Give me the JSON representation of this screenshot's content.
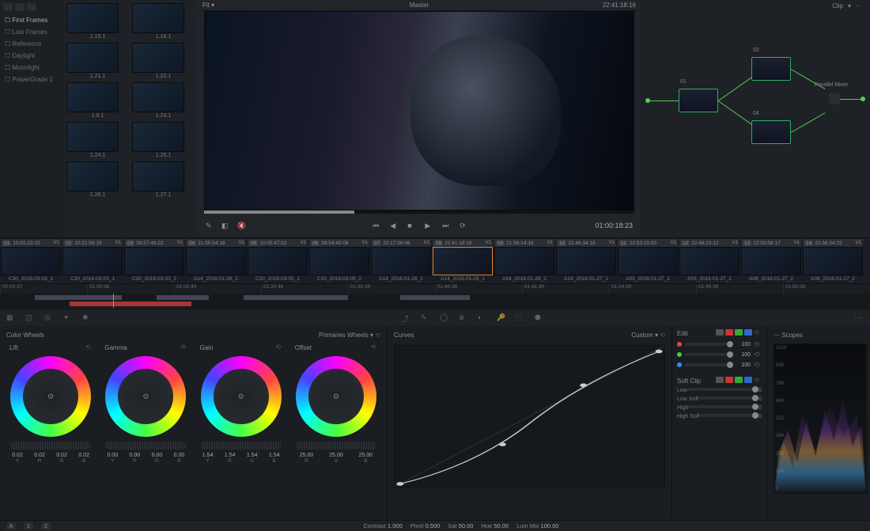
{
  "header": {
    "fit": "Fit",
    "master": "Master",
    "timecode_top": "22:41:18:16",
    "clip_label": "Clip"
  },
  "tags": [
    "First Frames",
    "Last Frames",
    "Reference",
    "Daylight",
    "Moonlight",
    "PowerGrade 1"
  ],
  "thumbs": [
    {
      "label": "1.15.1"
    },
    {
      "label": "1.16.1"
    },
    {
      "label": "1.21.1"
    },
    {
      "label": "1.22.1"
    },
    {
      "label": "1.9.1"
    },
    {
      "label": "1.23.1"
    },
    {
      "label": "1.24.1"
    },
    {
      "label": "1.25.1"
    },
    {
      "label": "1.26.1"
    },
    {
      "label": "1.27.1"
    }
  ],
  "transport": {
    "timecode": "01:00:18:23"
  },
  "nodes": {
    "n1": "01",
    "n2": "02",
    "n3": "04",
    "mixer": "Parallel Mixer"
  },
  "clips": [
    {
      "n": "01",
      "tc": "10:01:23:15",
      "name": "C30_2016-03-03_1"
    },
    {
      "n": "02",
      "tc": "10:21:59:15",
      "name": "C30_2016-03-03_1"
    },
    {
      "n": "03",
      "tc": "09:57:46:22",
      "name": "C30_2016-03-03_2"
    },
    {
      "n": "04",
      "tc": "21:55:54:18",
      "name": "A14_2016-01-28_2"
    },
    {
      "n": "05",
      "tc": "10:05:47:02",
      "name": "C30_2016-03-05_1"
    },
    {
      "n": "06",
      "tc": "09:54:40:08",
      "name": "C30_2016-03-05_2"
    },
    {
      "n": "07",
      "tc": "22:17:36:06",
      "name": "A14_2016-01-28_1"
    },
    {
      "n": "08",
      "tc": "22:41:18:16",
      "name": "A14_2016-01-28_1",
      "active": true
    },
    {
      "n": "09",
      "tc": "21:56:14:16",
      "name": "A54_2016-01-28_2"
    },
    {
      "n": "10",
      "tc": "22:46:34:18",
      "name": "A14_2016-01-27_1"
    },
    {
      "n": "11",
      "tc": "22:53:15:00",
      "name": "A03_2016-01-27_2"
    },
    {
      "n": "12",
      "tc": "22:48:23:12",
      "name": "A03_2016-01-27_2"
    },
    {
      "n": "13",
      "tc": "22:03:58:17",
      "name": "A08_2016-01-27_2"
    },
    {
      "n": "14",
      "tc": "22:36:34:22",
      "name": "A08_2016-01-27_2"
    }
  ],
  "timeline_ticks": [
    "00:00:37",
    "01:00:36",
    "01:00:40",
    "01:20:46",
    "01:30:39",
    "01:40:36",
    "01:41:40",
    "01:04:39",
    "01:45:39",
    "01:50:39"
  ],
  "wheels": {
    "title": "Color Wheels",
    "mode": "Primaries Wheels",
    "items": [
      {
        "name": "Lift",
        "vals": [
          {
            "n": "0.02",
            "l": "Y"
          },
          {
            "n": "0.02",
            "l": "R"
          },
          {
            "n": "0.02",
            "l": "G"
          },
          {
            "n": "0.02",
            "l": "B"
          }
        ]
      },
      {
        "name": "Gamma",
        "vals": [
          {
            "n": "0.00",
            "l": "Y"
          },
          {
            "n": "0.00",
            "l": "R"
          },
          {
            "n": "0.00",
            "l": "G"
          },
          {
            "n": "0.00",
            "l": "B"
          }
        ]
      },
      {
        "name": "Gain",
        "vals": [
          {
            "n": "1.54",
            "l": "Y"
          },
          {
            "n": "1.54",
            "l": "R"
          },
          {
            "n": "1.54",
            "l": "G"
          },
          {
            "n": "1.54",
            "l": "B"
          }
        ]
      },
      {
        "name": "Offset",
        "vals": [
          {
            "n": "25.00",
            "l": "R"
          },
          {
            "n": "25.00",
            "l": "G"
          },
          {
            "n": "25.00",
            "l": "B"
          }
        ]
      }
    ]
  },
  "curves": {
    "title": "Curves",
    "mode": "Custom"
  },
  "edit": {
    "title": "Edit",
    "sliders": [
      {
        "color": "#e44",
        "val": "100"
      },
      {
        "color": "#4c4",
        "val": "100"
      },
      {
        "color": "#48e",
        "val": "100"
      }
    ]
  },
  "softclip": {
    "title": "Soft Clip",
    "rows": [
      {
        "label": "Low",
        "val": "0"
      },
      {
        "label": "Low Soft",
        "val": "0"
      },
      {
        "label": "High",
        "val": "0"
      },
      {
        "label": "High Soft",
        "val": "0"
      }
    ]
  },
  "scopes": {
    "title": "Scopes",
    "scale": [
      "1023",
      "896",
      "768",
      "640",
      "512",
      "384",
      "256",
      "128",
      "0"
    ]
  },
  "status": {
    "pages": [
      "1",
      "2"
    ],
    "contrast_l": "Contrast",
    "contrast": "1.000",
    "pivot_l": "Pivot",
    "pivot": "0.500",
    "sat_l": "Sat",
    "sat": "50.00",
    "hue_l": "Hue",
    "hue": "50.00",
    "lummix_l": "Lum Mix",
    "lummix": "100.00"
  }
}
